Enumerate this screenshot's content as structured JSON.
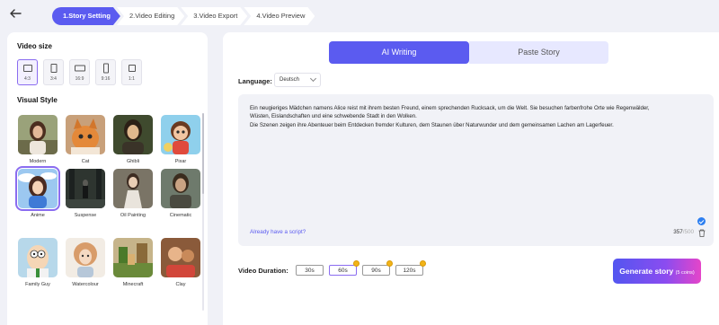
{
  "steps": [
    {
      "label": "1.Story Setting",
      "active": true
    },
    {
      "label": "2.Video Editing",
      "active": false
    },
    {
      "label": "3.Video Export",
      "active": false
    },
    {
      "label": "4.Video Preview",
      "active": false
    }
  ],
  "left": {
    "video_size_title": "Video size",
    "sizes": [
      {
        "label": "4:3",
        "selected": true
      },
      {
        "label": "3:4",
        "selected": false
      },
      {
        "label": "16:9",
        "selected": false
      },
      {
        "label": "9:16",
        "selected": false
      },
      {
        "label": "1:1",
        "selected": false
      }
    ],
    "visual_style_title": "Visual Style",
    "styles": [
      {
        "label": "Modern",
        "selected": false
      },
      {
        "label": "Cat",
        "selected": false
      },
      {
        "label": "Ghibli",
        "selected": false
      },
      {
        "label": "Pixar",
        "selected": false
      },
      {
        "label": "Anime",
        "selected": true
      },
      {
        "label": "Suspense",
        "selected": false
      },
      {
        "label": "Oil Painting",
        "selected": false
      },
      {
        "label": "Cinematic",
        "selected": false
      },
      {
        "label": "Family Guy",
        "selected": false
      },
      {
        "label": "Watercolour",
        "selected": false
      },
      {
        "label": "Minecraft",
        "selected": false
      },
      {
        "label": "Clay",
        "selected": false
      }
    ]
  },
  "right": {
    "tabs": {
      "ai_writing": "AI Writing",
      "paste_story": "Paste Story"
    },
    "language_label": "Language:",
    "language_value": "Deutsch",
    "story_lines": [
      "Ein neugieriges Mädchen namens Alice reist mit ihrem besten Freund, einem sprechenden Rucksack, um die Welt. Sie besuchen farbenfrohe Orte wie Regenwälder,",
      "Wüsten, Eislandschaften und eine schwebende Stadt in den Wolken.",
      "Die Szenen zeigen ihre Abenteuer beim Entdecken fremder Kulturen, dem Staunen über Naturwunder und dem gemeinsamen Lachen am Lagerfeuer."
    ],
    "already_script": "Already have a script?",
    "char_count": "357",
    "char_max": "/500",
    "duration_label": "Video Duration:",
    "durations": [
      {
        "label": "30s",
        "selected": false,
        "coin": false
      },
      {
        "label": "60s",
        "selected": true,
        "coin": true
      },
      {
        "label": "90s",
        "selected": false,
        "coin": true
      },
      {
        "label": "120s",
        "selected": false,
        "coin": true
      }
    ],
    "generate_label": "Generate story",
    "generate_cost": "(5 coins)"
  },
  "colors": {
    "accent": "#5b5bf0",
    "selected_border": "#8a6cf0",
    "coin": "#f2b418"
  }
}
